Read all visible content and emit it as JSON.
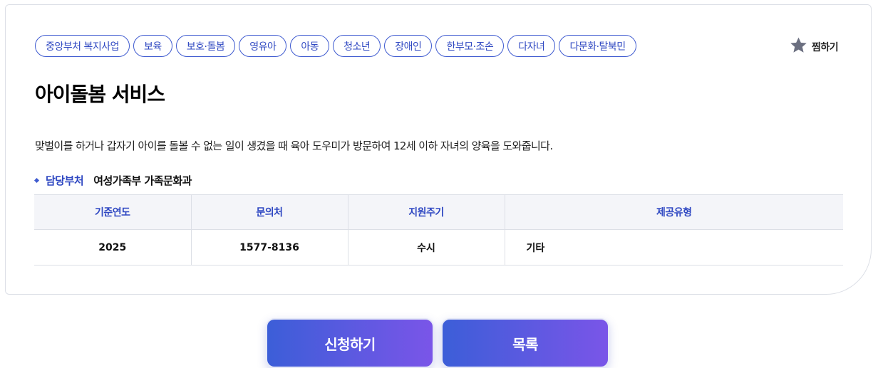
{
  "tags": [
    "중앙부처 복지사업",
    "보육",
    "보호·돌봄",
    "영유아",
    "아동",
    "청소년",
    "장애인",
    "한부모·조손",
    "다자녀",
    "다문화·탈북민"
  ],
  "favorite": {
    "label": "찜하기",
    "icon": "star-icon",
    "icon_color": "#6b6f80"
  },
  "title": "아이돌봄 서비스",
  "description": "맞벌이를 하거나 갑자기 아이를 돌볼 수 없는 일이 생겼을 때 육아 도우미가 방문하여 12세 이하 자녀의 양육을 도와줍니다.",
  "department": {
    "label": "담당부처",
    "value": "여성가족부 가족문화과"
  },
  "info_table": {
    "headers": [
      "기준연도",
      "문의처",
      "지원주기",
      "제공유형"
    ],
    "row": [
      "2025",
      "1577-8136",
      "수시",
      "기타"
    ]
  },
  "buttons": {
    "apply": "신청하기",
    "list": "목록"
  },
  "colors": {
    "accent": "#2f48c2",
    "gradient_start": "#3c5ed8",
    "gradient_end": "#7a55e8",
    "header_bg": "#f4f5f9"
  }
}
